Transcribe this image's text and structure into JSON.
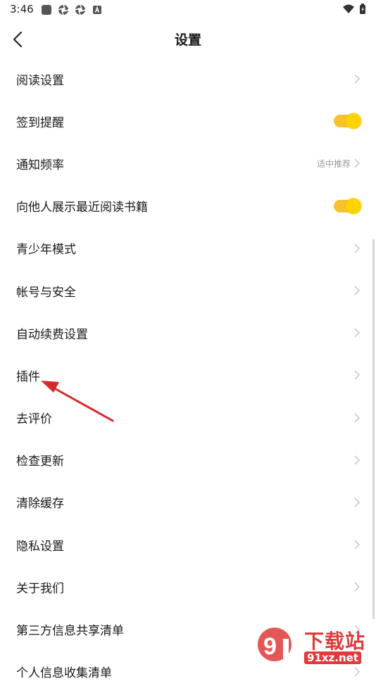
{
  "status_bar": {
    "time": "3:46"
  },
  "header": {
    "title": "设置"
  },
  "settings": [
    {
      "label": "阅读设置",
      "type": "chevron"
    },
    {
      "label": "签到提醒",
      "type": "toggle",
      "on": true
    },
    {
      "label": "通知频率",
      "type": "chevron",
      "value": "适中推荐"
    },
    {
      "label": "向他人展示最近阅读书籍",
      "type": "toggle",
      "on": true
    },
    {
      "label": "青少年模式",
      "type": "chevron"
    },
    {
      "label": "帐号与安全",
      "type": "chevron"
    },
    {
      "label": "自动续费设置",
      "type": "chevron"
    },
    {
      "label": "插件",
      "type": "chevron"
    },
    {
      "label": "去评价",
      "type": "chevron"
    },
    {
      "label": "检查更新",
      "type": "chevron"
    },
    {
      "label": "清除缓存",
      "type": "chevron"
    },
    {
      "label": "隐私设置",
      "type": "chevron"
    },
    {
      "label": "关于我们",
      "type": "chevron"
    },
    {
      "label": "第三方信息共享清单",
      "type": "chevron"
    },
    {
      "label": "个人信息收集清单",
      "type": "chevron"
    }
  ],
  "watermark": {
    "name": "下载站",
    "url": "91xz.net"
  },
  "colors": {
    "accent": "#ffd200",
    "annotation_arrow": "#d42a2a",
    "watermark": "#e03a3a"
  }
}
